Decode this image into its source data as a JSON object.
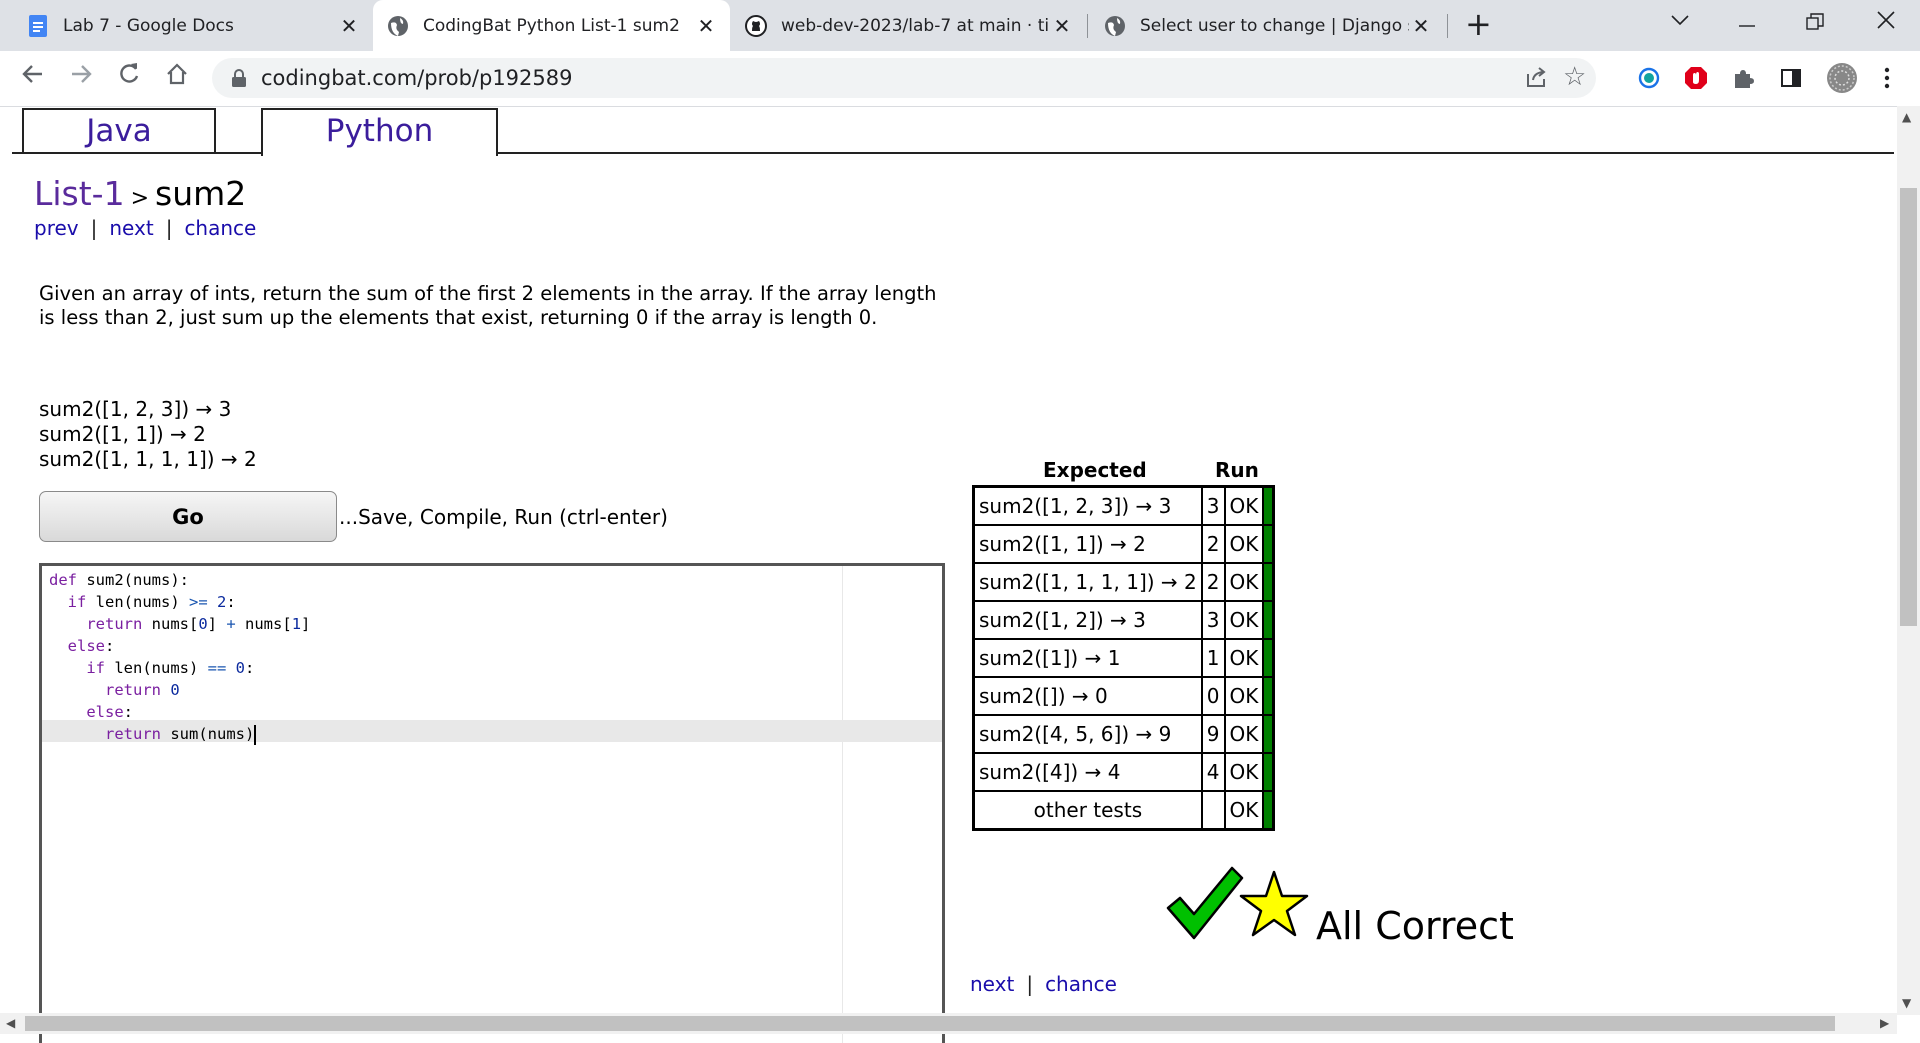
{
  "browser": {
    "tabs": [
      {
        "title": "Lab 7 - Google Docs",
        "icon": "google-docs-icon"
      },
      {
        "title": "CodingBat Python List-1 sum2",
        "icon": "globe-icon"
      },
      {
        "title": "web-dev-2023/lab-7 at main · tin",
        "icon": "github-icon"
      },
      {
        "title": "Select user to change | Django si",
        "icon": "globe-icon"
      }
    ],
    "new_tab_label": "+",
    "url": "codingbat.com/prob/p192589"
  },
  "page": {
    "lang_tabs": [
      "Java",
      "Python"
    ],
    "breadcrumb": {
      "parent": "List-1",
      "separator": ">",
      "current": "sum2"
    },
    "nav": {
      "prev": "prev",
      "next": "next",
      "chance": "chance",
      "bar": "|"
    },
    "description": "Given an array of ints, return the sum of the first 2 elements in the array. If the array length is less than 2, just sum up the elements that exist, returning 0 if the array is length 0.",
    "examples": [
      "sum2([1, 2, 3]) → 3",
      "sum2([1, 1]) → 2",
      "sum2([1, 1, 1, 1]) → 2"
    ],
    "go_button": "Go",
    "go_hint": "...Save, Compile, Run (ctrl-enter)",
    "code_lines": [
      "def sum2(nums):",
      "  if len(nums) >= 2:",
      "    return nums[0] + nums[1]",
      "  else:",
      "    if len(nums) == 0:",
      "      return 0",
      "    else:",
      "      return sum(nums)"
    ],
    "results": {
      "header_expected": "Expected",
      "header_run": "Run",
      "rows": [
        {
          "expected": "sum2([1, 2, 3]) → 3",
          "run": "3",
          "status": "OK"
        },
        {
          "expected": "sum2([1, 1]) → 2",
          "run": "2",
          "status": "OK"
        },
        {
          "expected": "sum2([1, 1, 1, 1]) → 2",
          "run": "2",
          "status": "OK"
        },
        {
          "expected": "sum2([1, 2]) → 3",
          "run": "3",
          "status": "OK"
        },
        {
          "expected": "sum2([1]) → 1",
          "run": "1",
          "status": "OK"
        },
        {
          "expected": "sum2([]) → 0",
          "run": "0",
          "status": "OK"
        },
        {
          "expected": "sum2([4, 5, 6]) → 9",
          "run": "9",
          "status": "OK"
        },
        {
          "expected": "sum2([4]) → 4",
          "run": "4",
          "status": "OK"
        },
        {
          "expected": "other tests",
          "run": "",
          "status": "OK"
        }
      ],
      "pass_color": "#008000"
    },
    "all_correct": "All Correct",
    "bottom_nav": {
      "next": "next",
      "chance": "chance",
      "bar": "|"
    }
  }
}
